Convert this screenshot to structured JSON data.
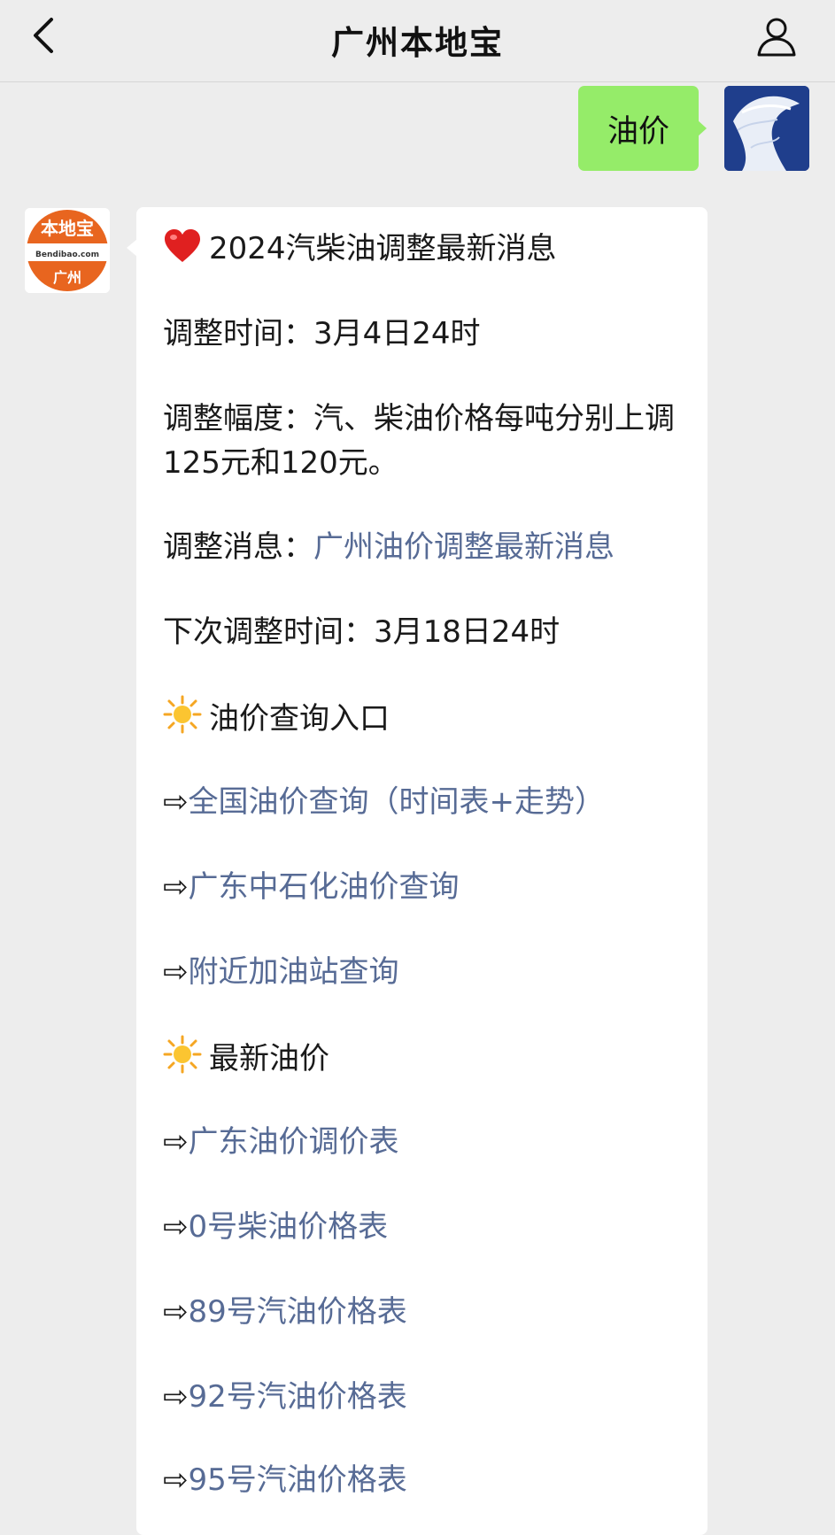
{
  "header": {
    "title": "广州本地宝"
  },
  "chat": {
    "sent_message": "油价",
    "bot_logo": {
      "brand_text": "本地宝",
      "domain_text": "Bendibao.com",
      "city_text": "广州"
    },
    "reply": {
      "headline": "2024汽柴油调整最新消息",
      "time_label": "调整时间：",
      "time_value": "3月4日24时",
      "range_label": "调整幅度：",
      "range_value": "汽、柴油价格每吨分别上调125元和120元。",
      "news_label": "调整消息：",
      "news_link": "广州油价调整最新消息",
      "next_label": "下次调整时间：",
      "next_value": "3月18日24时",
      "section1_title": "油价查询入口",
      "section1_links": [
        "全国油价查询（时间表+走势）",
        "广东中石化油价查询",
        "附近加油站查询"
      ],
      "section2_title": "最新油价",
      "section2_links": [
        "广东油价调价表",
        "0号柴油价格表",
        "89号汽油价格表",
        "92号汽油价格表",
        "95号汽油价格表"
      ],
      "arrow": "⇨"
    }
  },
  "icons": {
    "back": "chevron-left-icon",
    "profile": "person-icon",
    "heart": "red-heart-icon",
    "sun": "sun-icon"
  },
  "colors": {
    "background": "#ededed",
    "sent_bubble": "#95ec69",
    "link": "#576b95",
    "logo_orange": "#e8651f"
  }
}
